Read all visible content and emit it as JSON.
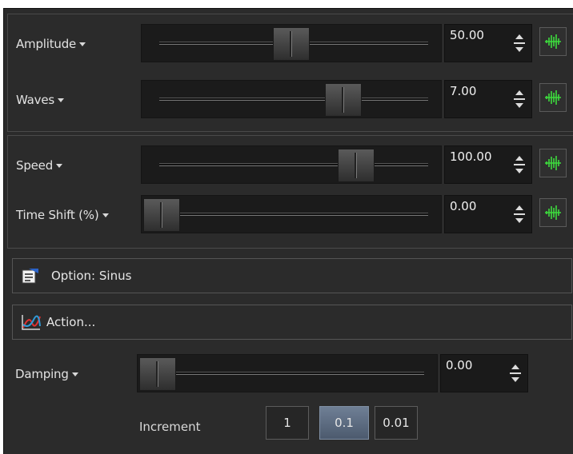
{
  "controls": {
    "amplitude": {
      "label": "Amplitude",
      "value": "50.00",
      "slider_fraction": 0.5
    },
    "waves": {
      "label": "Waves",
      "value": "7.00",
      "slider_fraction": 0.7
    },
    "speed": {
      "label": "Speed",
      "value": "100.00",
      "slider_fraction": 0.75
    },
    "time_shift": {
      "label": "Time Shift (%)",
      "value": "0.00",
      "slider_fraction": 0.0
    },
    "damping": {
      "label": "Damping",
      "value": "0.00",
      "slider_fraction": 0.0
    }
  },
  "option_button": {
    "label": "Option: Sinus",
    "icon": "properties-icon"
  },
  "action_button": {
    "label": "Action...",
    "icon": "curve-graph-icon"
  },
  "increment": {
    "label": "Increment",
    "options": [
      "1",
      "0.1",
      "0.01"
    ],
    "selected": "0.1"
  },
  "colors": {
    "panel_bg": "#2b2b2b",
    "accent_green": "#3ddc3d",
    "selected_increment": "#5d6c82"
  }
}
